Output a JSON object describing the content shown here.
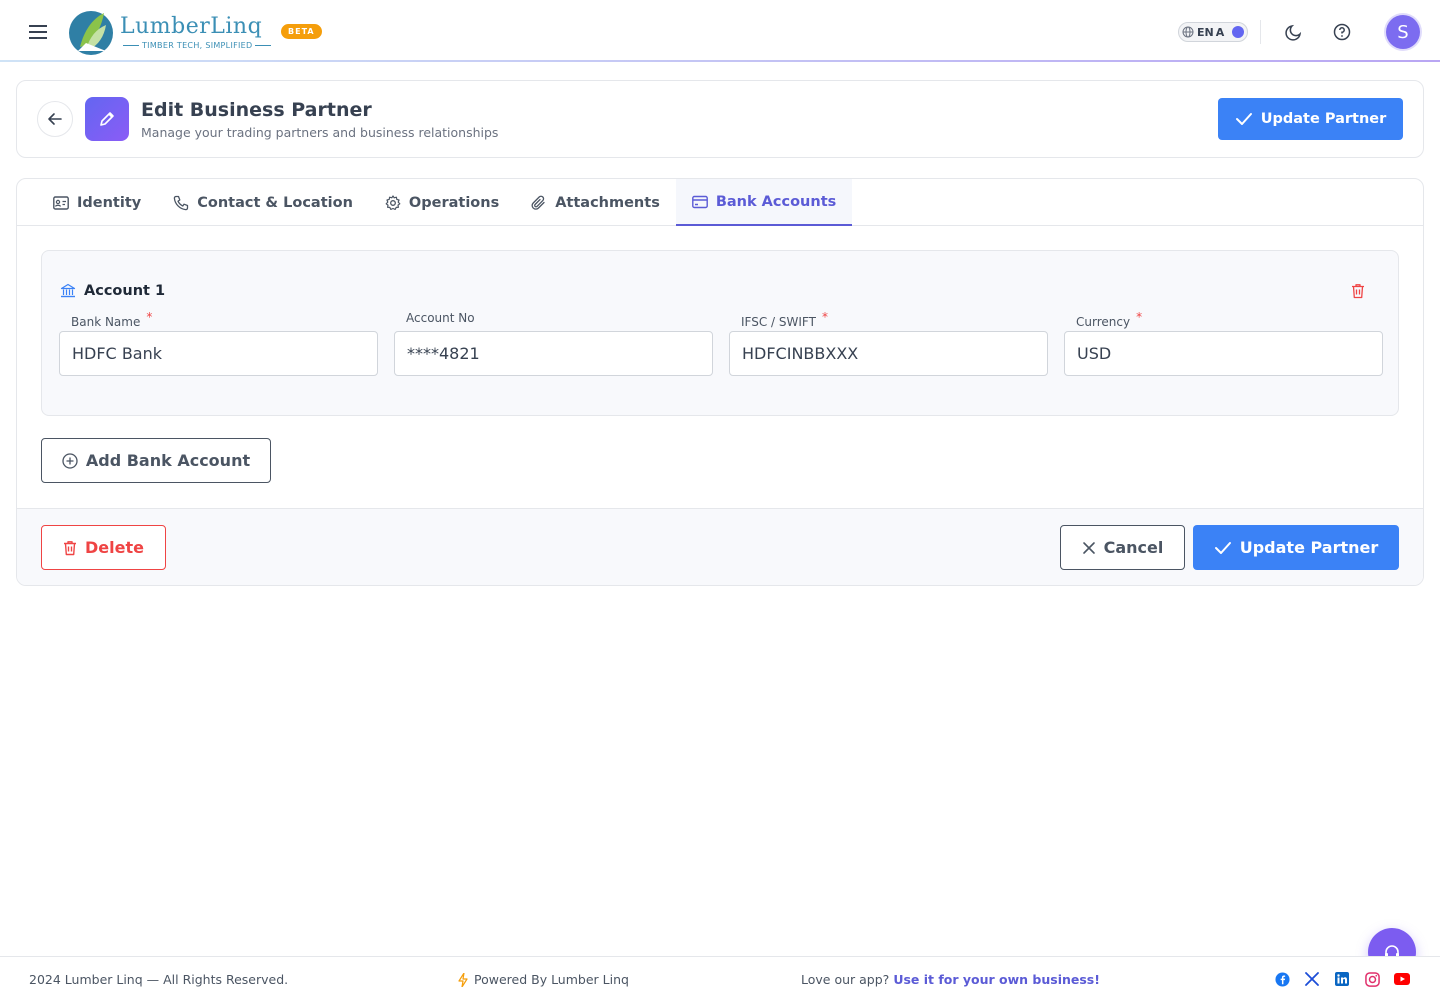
{
  "header": {
    "brand_name": "LumberLinq",
    "brand_tagline": "TIMBER TECH, SIMPLIFIED",
    "beta_badge": "BETA",
    "lang_label": "EN",
    "lang_alt": "A",
    "avatar_initial": "S"
  },
  "page": {
    "title": "Edit Business Partner",
    "subtitle": "Manage your trading partners and business relationships",
    "update_label": "Update Partner"
  },
  "tabs": [
    {
      "label": "Identity",
      "icon": "id-card-icon"
    },
    {
      "label": "Contact & Location",
      "icon": "phone-icon"
    },
    {
      "label": "Operations",
      "icon": "gear-icon"
    },
    {
      "label": "Attachments",
      "icon": "paperclip-icon"
    },
    {
      "label": "Bank Accounts",
      "icon": "credit-card-icon",
      "active": true
    }
  ],
  "account": {
    "heading": "Account 1",
    "fields": [
      {
        "label": "Bank Name",
        "required": "*",
        "value": "HDFC Bank"
      },
      {
        "label": "Account No",
        "value": "****4821"
      },
      {
        "label": "IFSC / SWIFT",
        "required": "*",
        "value": "HDFCINBBXXX"
      },
      {
        "label": "Currency",
        "required": "*",
        "value": "USD"
      }
    ]
  },
  "actions": {
    "add_bank_account": "Add Bank Account",
    "delete": "Delete",
    "cancel": "Cancel",
    "update": "Update Partner"
  },
  "footer": {
    "copyright": "2024 Lumber Linq — All Rights Reserved.",
    "powered": "Powered By Lumber Linq",
    "love_text": "Love our app?",
    "love_link": "Use it for your own business!"
  },
  "colors": {
    "primary": "#3b82f6",
    "accent": "#5b5bd6",
    "danger": "#ef4444",
    "beta": "#f59e0b"
  }
}
